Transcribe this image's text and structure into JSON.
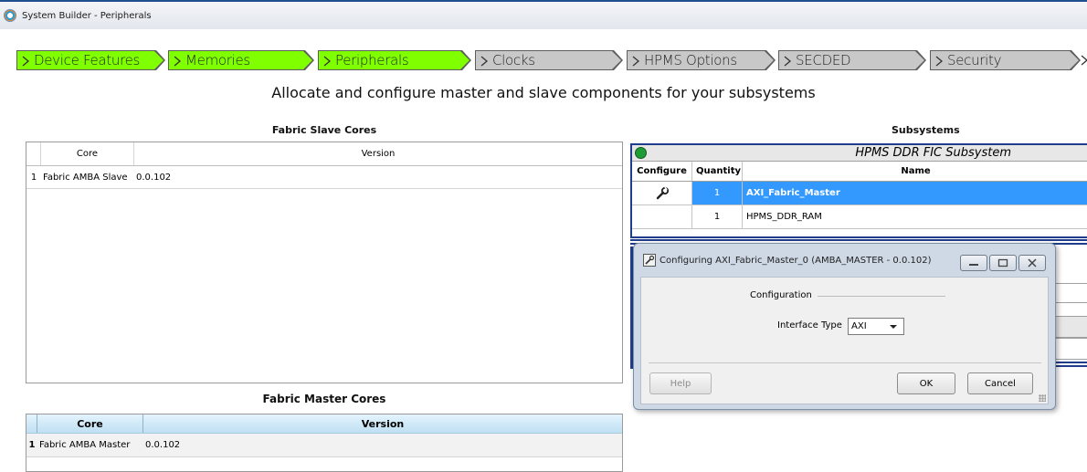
{
  "window": {
    "title": "System Builder - Peripherals"
  },
  "wizard": {
    "steps": [
      {
        "label": "Device Features",
        "state": "done"
      },
      {
        "label": "Memories",
        "state": "done"
      },
      {
        "label": "Peripherals",
        "state": "done"
      },
      {
        "label": "Clocks",
        "state": "todo"
      },
      {
        "label": "HPMS Options",
        "state": "todo"
      },
      {
        "label": "SECDED",
        "state": "todo"
      },
      {
        "label": "Security",
        "state": "todo"
      }
    ],
    "done_color": "#7fff00",
    "todo_color": "#c8c8c8"
  },
  "heading": "Allocate and configure master and slave components for your subsystems",
  "slave_cores": {
    "title": "Fabric Slave Cores",
    "columns": [
      "Core",
      "Version"
    ],
    "rows": [
      {
        "index": "1",
        "core": "Fabric AMBA Slave",
        "version": "0.0.102"
      }
    ]
  },
  "master_cores": {
    "title": "Fabric Master Cores",
    "columns": [
      "Core",
      "Version"
    ],
    "rows": [
      {
        "index": "1",
        "core": "Fabric AMBA Master",
        "version": "0.0.102"
      }
    ]
  },
  "subsystems": {
    "title": "Subsystems",
    "panel_title": "HPMS DDR FIC Subsystem",
    "status_color": "#1e9c35",
    "columns": [
      "Configure",
      "Quantity",
      "Name"
    ],
    "rows": [
      {
        "quantity": "1",
        "name": "AXI_Fabric_Master",
        "selected": true,
        "configure_icon": "wrench-icon"
      },
      {
        "quantity": "1",
        "name": "HPMS_DDR_RAM",
        "selected": false
      }
    ],
    "selection_color": "#3399ff"
  },
  "dialog": {
    "title": "Configuring AXI_Fabric_Master_0 (AMBA_MASTER - 0.0.102)",
    "group_label": "Configuration",
    "interface_type_label": "Interface Type",
    "interface_type_value": "AXI",
    "help_label": "Help",
    "ok_label": "OK",
    "cancel_label": "Cancel"
  }
}
